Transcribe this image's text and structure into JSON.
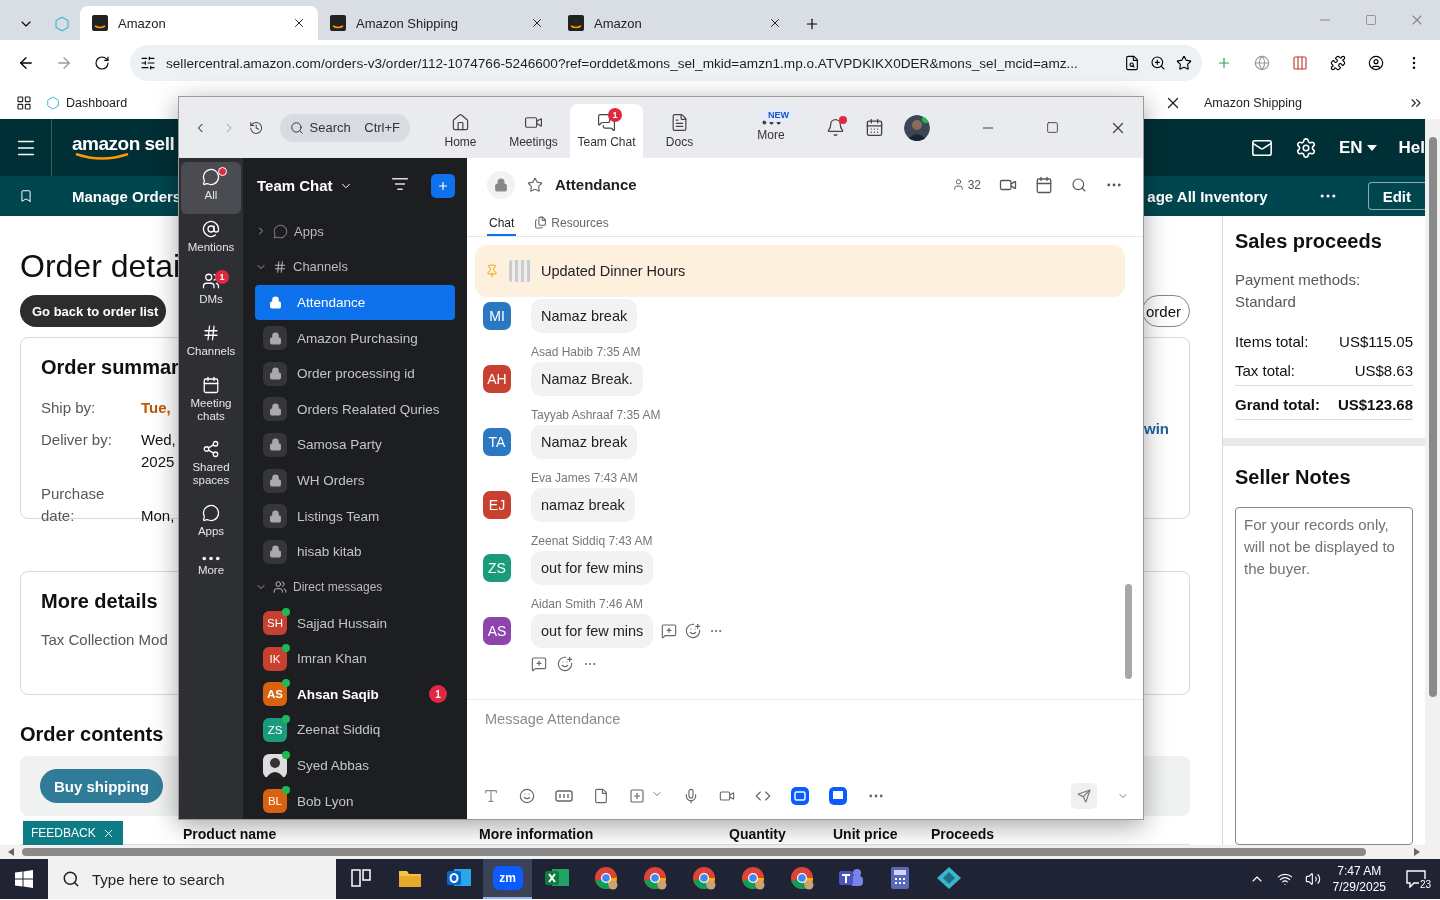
{
  "browser": {
    "tabs": [
      {
        "title": "Amazon",
        "selected": true
      },
      {
        "title": "Amazon Shipping",
        "selected": false
      },
      {
        "title": "Amazon",
        "selected": false
      }
    ],
    "url": "sellercentral.amazon.com/orders-v3/order/112-1074766-5246600?ref=orddet&mons_sel_mkid=amzn1.mp.o.ATVPDKIKX0DER&mons_sel_mcid=amz...",
    "bookmarks": [
      "Dashboard",
      "Amazon Shipping"
    ]
  },
  "amazon": {
    "logo": "amazon sell",
    "nav": [
      "Manage Orders",
      "age All Inventory"
    ],
    "language": "EN",
    "help": "Hel",
    "edit_button": "Edit",
    "title": "Order detai",
    "back_button": "Go back to order list",
    "order_button": "order",
    "summary": {
      "title": "Order summar",
      "link": "win",
      "rows": [
        {
          "label": "Ship by:",
          "value": "Tue,",
          "highlight": true
        },
        {
          "label": "Deliver by:",
          "value": "Wed,\n2025",
          "highlight": false
        },
        {
          "label": "Purchase date:",
          "value": "Mon,",
          "highlight": false
        }
      ]
    },
    "more_details": {
      "title": "More details",
      "rows": [
        "Tax Collection Mod"
      ]
    },
    "contents": {
      "title": "Order contents",
      "button": "Buy shipping",
      "columns": [
        "Product name",
        "More information",
        "Quantity",
        "Unit price",
        "Proceeds"
      ]
    },
    "feedback": "FEEDBACK",
    "sales": {
      "title": "Sales proceeds",
      "payment": "Payment methods: Standard",
      "rows": [
        {
          "label": "Items total:",
          "value": "US$115.05",
          "bold": false
        },
        {
          "label": "Tax total:",
          "value": "US$8.63",
          "bold": false
        },
        {
          "label": "Grand total:",
          "value": "US$123.68",
          "bold": true
        }
      ]
    },
    "seller_notes": {
      "title": "Seller Notes",
      "placeholder": "For your records only, will not be displayed to the buyer."
    }
  },
  "zoom": {
    "search": {
      "placeholder": "Search",
      "shortcut": "Ctrl+F"
    },
    "nav": [
      {
        "label": "Home",
        "selected": false
      },
      {
        "label": "Meetings",
        "selected": false
      },
      {
        "label": "Team Chat",
        "selected": true,
        "badge": "1"
      },
      {
        "label": "Docs",
        "selected": false
      },
      {
        "label": "More",
        "selected": false,
        "tag": "NEW"
      }
    ],
    "rail": [
      {
        "label": "All",
        "selected": true,
        "dot": true
      },
      {
        "label": "Mentions",
        "selected": false,
        "dot": false
      },
      {
        "label": "DMs",
        "selected": false,
        "dot": false,
        "badge": "1"
      },
      {
        "label": "Channels",
        "selected": false,
        "dot": false
      },
      {
        "label": "Meeting chats",
        "selected": false,
        "dot": false
      },
      {
        "label": "Shared spaces",
        "selected": false,
        "dot": false
      },
      {
        "label": "Apps",
        "selected": false,
        "dot": false
      },
      {
        "label": "More",
        "selected": false,
        "dot": false
      }
    ],
    "panel": {
      "title": "Team Chat",
      "apps": {
        "label": "Apps",
        "expanded": false
      },
      "channels": {
        "label": "Channels",
        "expanded": true,
        "items": [
          {
            "name": "Attendance",
            "selected": true
          },
          {
            "name": "Amazon Purchasing",
            "selected": false
          },
          {
            "name": "Order processing id",
            "selected": false
          },
          {
            "name": "Orders Realated Quries",
            "selected": false
          },
          {
            "name": "Samosa Party",
            "selected": false
          },
          {
            "name": "WH Orders",
            "selected": false
          },
          {
            "name": "Listings Team",
            "selected": false
          },
          {
            "name": "hisab kitab",
            "selected": false
          }
        ]
      },
      "dms": {
        "label": "Direct messages",
        "expanded": true,
        "items": [
          {
            "kind": "initials",
            "initials": "SH",
            "name": "Sajjad Hussain",
            "color": "#c8402f",
            "online": true,
            "unread": false
          },
          {
            "kind": "initials",
            "initials": "IK",
            "name": "Imran Khan",
            "color": "#c8402f",
            "online": true,
            "unread": false
          },
          {
            "kind": "initials",
            "initials": "AS",
            "name": "Ahsan Saqib",
            "color": "#d9620f",
            "online": true,
            "unread": true,
            "badge": "1"
          },
          {
            "kind": "initials",
            "initials": "ZS",
            "name": "Zeenat Siddiq",
            "color": "#1a9c7c",
            "online": true,
            "unread": false
          },
          {
            "kind": "photo",
            "name": "Syed Abbas",
            "online": true,
            "unread": false
          },
          {
            "kind": "initials",
            "initials": "BL",
            "name": "Bob Lyon",
            "color": "#d9620f",
            "online": true,
            "unread": false
          }
        ]
      }
    },
    "channel": {
      "name": "Attendance",
      "members": "32",
      "tabs": [
        {
          "label": "Chat",
          "selected": true
        },
        {
          "label": "Resources",
          "selected": false
        }
      ],
      "pinned": "Updated Dinner Hours",
      "messages": [
        {
          "initials": "MI",
          "color": "#2a78c2",
          "text": "Namaz break",
          "hovered": false
        },
        {
          "sender": "Asad Habib",
          "time": "7:35 AM",
          "initials": "AH",
          "color": "#c8402f",
          "text": "Namaz Break.",
          "hovered": false
        },
        {
          "sender": "Tayyab Ashraaf",
          "time": "7:35 AM",
          "initials": "TA",
          "color": "#2a78c2",
          "text": "Namaz break",
          "hovered": false
        },
        {
          "sender": "Eva James",
          "time": "7:43 AM",
          "initials": "EJ",
          "color": "#c8402f",
          "text": "namaz break",
          "hovered": false
        },
        {
          "sender": "Zeenat Siddiq",
          "time": "7:43 AM",
          "initials": "ZS",
          "color": "#1a9c7c",
          "text": "out for few mins",
          "hovered": false
        },
        {
          "sender": "Aidan Smith",
          "time": "7:46 AM",
          "initials": "AS",
          "color": "#8e44ad",
          "text": "out for few mins",
          "hovered": true
        }
      ],
      "composer": {
        "placeholder": "Message Attendance"
      }
    }
  },
  "taskbar": {
    "search_placeholder": "Type here to search",
    "apps": [
      {
        "kind": "taskview",
        "selected": false
      },
      {
        "kind": "folder",
        "selected": false
      },
      {
        "kind": "outlook",
        "selected": false
      },
      {
        "kind": "zoom",
        "label": "zm",
        "selected": true
      },
      {
        "kind": "excel",
        "selected": false
      },
      {
        "kind": "chrome",
        "selected": false
      },
      {
        "kind": "chrome",
        "selected": false
      },
      {
        "kind": "chrome",
        "selected": false
      },
      {
        "kind": "chrome",
        "selected": false
      },
      {
        "kind": "chrome",
        "selected": false
      },
      {
        "kind": "teams",
        "selected": false
      },
      {
        "kind": "calculator",
        "selected": false
      },
      {
        "kind": "diamond",
        "selected": false
      }
    ],
    "time": "7:47 AM",
    "date": "7/29/2025",
    "notifications": "23"
  }
}
